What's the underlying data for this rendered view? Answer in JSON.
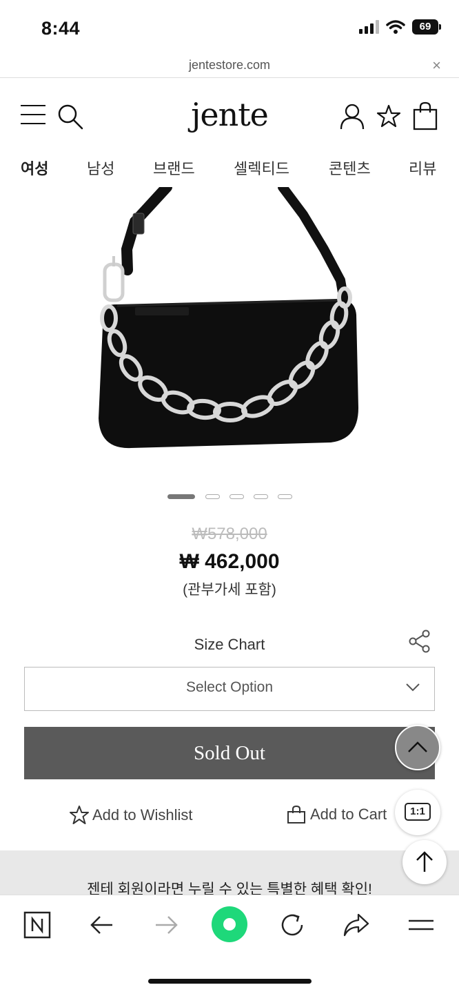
{
  "status_bar": {
    "time": "8:44",
    "battery": "69"
  },
  "browser": {
    "url": "jentestore.com",
    "close": "×"
  },
  "header": {
    "logo": "jente"
  },
  "category_nav": [
    "여성",
    "남성",
    "브랜드",
    "셀렉티드",
    "콘텐츠",
    "리뷰"
  ],
  "carousel": {
    "total": 5,
    "active_index": 0
  },
  "product": {
    "original_price": "₩578,000",
    "sale_price": "₩ 462,000",
    "price_note": "(관부가세 포함)"
  },
  "options": {
    "size_chart": "Size Chart",
    "select_placeholder": "Select Option"
  },
  "actions": {
    "sold_out": "Sold Out",
    "wishlist": "Add to Wishlist",
    "cart": "Add to Cart",
    "chat": "1:1"
  },
  "banner": {
    "text": "젠테 회원이라면 누릴 수 있는 특별한 혜택 확인!"
  },
  "colors": {
    "sold_out_bg": "#5a5a5a",
    "green_button": "#1ed87a",
    "banner_bg": "#e8e8e8"
  }
}
